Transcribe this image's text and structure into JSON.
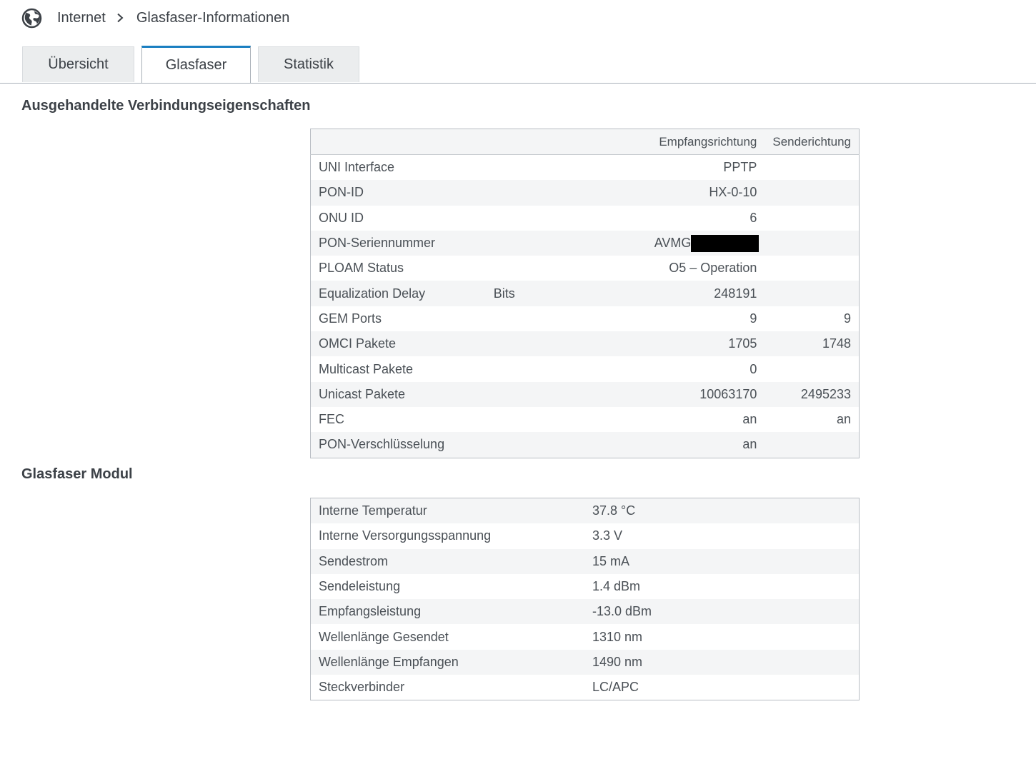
{
  "breadcrumb": {
    "parent": "Internet",
    "current": "Glasfaser-Informationen"
  },
  "tabs": [
    {
      "label": "Übersicht",
      "active": false
    },
    {
      "label": "Glasfaser",
      "active": true
    },
    {
      "label": "Statistik",
      "active": false
    }
  ],
  "colors": {
    "accent": "#1a7fc1",
    "text": "#3c4147",
    "row_stripe": "#f4f5f6"
  },
  "connection": {
    "heading": "Ausgehandelte Verbindungseigenschaften",
    "col_rx": "Empfangsrichtung",
    "col_tx": "Senderichtung",
    "rows": [
      {
        "label": "UNI Interface",
        "unit": "",
        "rx": "PPTP",
        "tx": ""
      },
      {
        "label": "PON-ID",
        "unit": "",
        "rx": "HX-0-10",
        "tx": ""
      },
      {
        "label": "ONU ID",
        "unit": "",
        "rx": "6",
        "tx": ""
      },
      {
        "label": "PON-Seriennummer",
        "unit": "",
        "rx": "AVMG",
        "tx": ""
      },
      {
        "label": "PLOAM Status",
        "unit": "",
        "rx": "O5 – Operation",
        "tx": ""
      },
      {
        "label": "Equalization Delay",
        "unit": "Bits",
        "rx": "248191",
        "tx": ""
      },
      {
        "label": "GEM Ports",
        "unit": "",
        "rx": "9",
        "tx": "9"
      },
      {
        "label": "OMCI Pakete",
        "unit": "",
        "rx": "1705",
        "tx": "1748"
      },
      {
        "label": "Multicast Pakete",
        "unit": "",
        "rx": "0",
        "tx": ""
      },
      {
        "label": "Unicast Pakete",
        "unit": "",
        "rx": "10063170",
        "tx": "2495233"
      },
      {
        "label": "FEC",
        "unit": "",
        "rx": "an",
        "tx": "an"
      },
      {
        "label": "PON-Verschlüsselung",
        "unit": "",
        "rx": "an",
        "tx": ""
      }
    ]
  },
  "module": {
    "heading": "Glasfaser Modul",
    "rows": [
      {
        "label": "Interne Temperatur",
        "value": "37.8 °C"
      },
      {
        "label": "Interne Versorgungsspannung",
        "value": "3.3 V"
      },
      {
        "label": "Sendestrom",
        "value": "15 mA"
      },
      {
        "label": "Sendeleistung",
        "value": "1.4 dBm"
      },
      {
        "label": "Empfangsleistung",
        "value": "-13.0 dBm"
      },
      {
        "label": "Wellenlänge Gesendet",
        "value": "1310 nm"
      },
      {
        "label": "Wellenlänge Empfangen",
        "value": "1490 nm"
      },
      {
        "label": "Steckverbinder",
        "value": "LC/APC"
      }
    ]
  }
}
